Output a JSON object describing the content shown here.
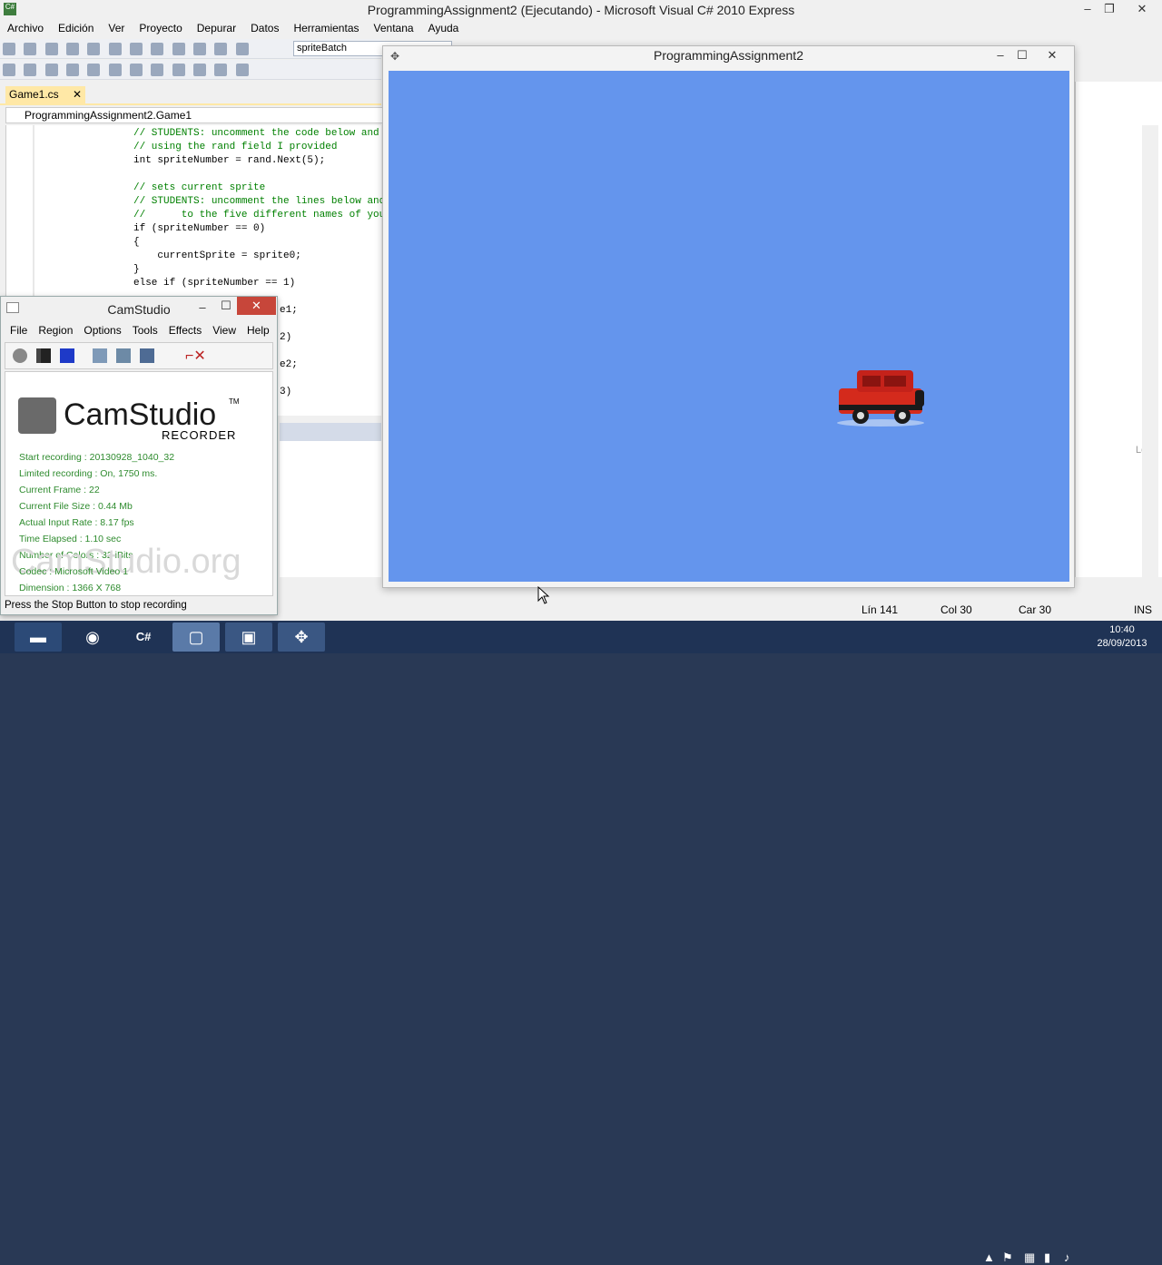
{
  "vs": {
    "title": "ProgrammingAssignment2 (Ejecutando) - Microsoft Visual C# 2010 Express",
    "menu": [
      "Archivo",
      "Edición",
      "Ver",
      "Proyecto",
      "Depurar",
      "Datos",
      "Herramientas",
      "Ventana",
      "Ayuda"
    ],
    "combo_value": "spriteBatch",
    "tab_label": "Game1.cs",
    "navbar_class": "ProgrammingAssignment2.Game1",
    "code_lines": [
      "// STUDENTS: uncomment the code below and",
      "// using the rand field I provided",
      "int spriteNumber = rand.Next(5);",
      "",
      "// sets current sprite",
      "// STUDENTS: uncomment the lines below and",
      "//      to the five different names of you",
      "if (spriteNumber == 0)",
      "{",
      "    currentSprite = sprite0;",
      "}",
      "else if (spriteNumber == 1)"
    ],
    "code_fragments": [
      "e1;",
      "2)",
      "e2;",
      "3)"
    ],
    "right_pane_label": "Leng",
    "status": {
      "line": "Lín 141",
      "col": "Col 30",
      "car": "Car 30",
      "mode": "INS"
    }
  },
  "game": {
    "title": "ProgrammingAssignment2",
    "background": "#6495ed"
  },
  "camstudio": {
    "title": "CamStudio",
    "menu": [
      "File",
      "Region",
      "Options",
      "Tools",
      "Effects",
      "View",
      "Help"
    ],
    "logo_text": "CamStudio",
    "logo_tm": "TM",
    "logo_sub": "RECORDER",
    "info": [
      "Start recording : 20130928_1040_32",
      "Limited recording : On, 1750 ms.",
      "Current Frame : 22",
      "Current File Size : 0.44 Mb",
      "Actual Input Rate : 8.17 fps",
      "Time Elapsed : 1.10 sec",
      "Number of Colors : 32 iBits",
      "Codec : Microsoft Video 1",
      "Dimension : 1366 X 768"
    ],
    "watermark": "CamStudio.org",
    "status": "Press the Stop Button to stop recording"
  },
  "taskbar": {
    "clock_time": "10:40",
    "clock_date": "28/09/2013",
    "icons": [
      "folder-icon",
      "chrome-icon",
      "csharp-icon",
      "camstudio-icon",
      "window-icon",
      "gamepad-icon"
    ]
  }
}
